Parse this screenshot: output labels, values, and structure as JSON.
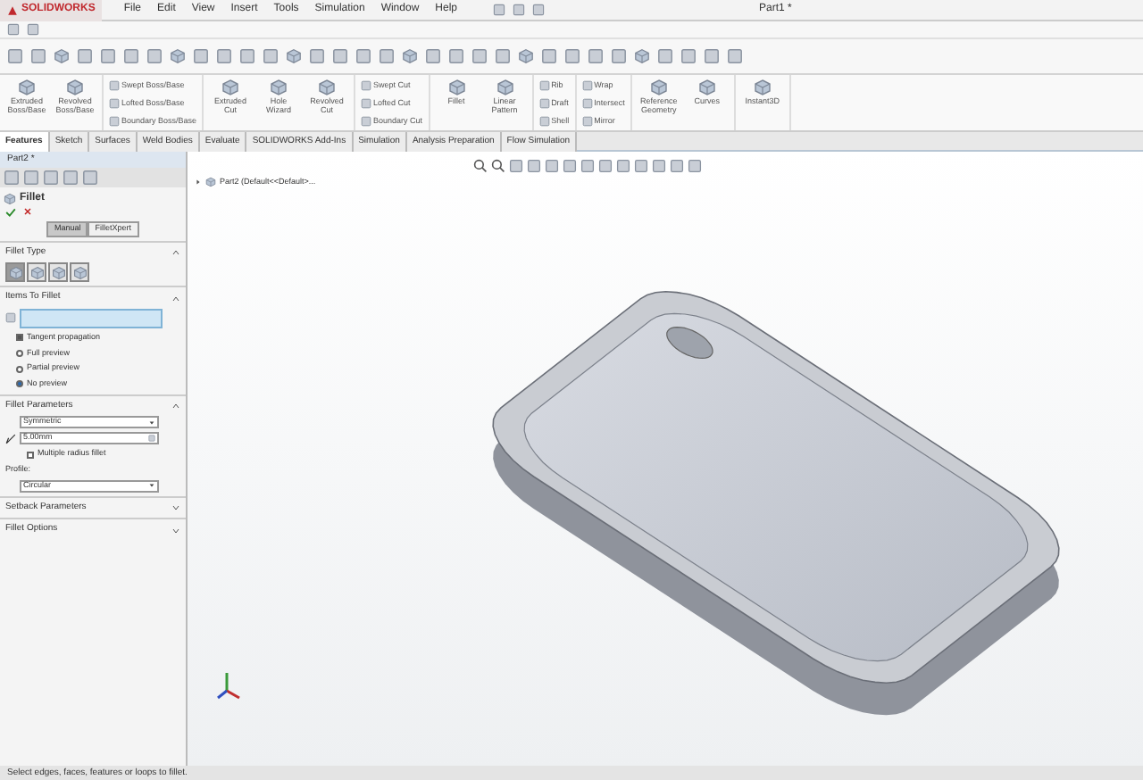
{
  "app": {
    "logo": "SOLIDWORKS",
    "menu": [
      "File",
      "Edit",
      "View",
      "Insert",
      "Tools",
      "Simulation",
      "Window",
      "Help"
    ],
    "title": "Part1 *"
  },
  "ribbon": [
    {
      "kind": "big",
      "labels": [
        "Extruded Boss/Base",
        "Revolved Boss/Base"
      ]
    },
    {
      "kind": "small",
      "labels": [
        "Swept Boss/Base",
        "Lofted Boss/Base",
        "Boundary Boss/Base"
      ]
    },
    {
      "kind": "big",
      "labels": [
        "Extruded Cut",
        "Hole Wizard",
        "Revolved Cut"
      ]
    },
    {
      "kind": "small",
      "labels": [
        "Swept Cut",
        "Lofted Cut",
        "Boundary Cut"
      ]
    },
    {
      "kind": "big",
      "labels": [
        "Fillet",
        "Linear Pattern"
      ]
    },
    {
      "kind": "small",
      "labels": [
        "Rib",
        "Draft",
        "Shell"
      ]
    },
    {
      "kind": "small",
      "labels": [
        "Wrap",
        "Intersect",
        "Mirror"
      ]
    },
    {
      "kind": "big",
      "labels": [
        "Reference Geometry",
        "Curves"
      ]
    },
    {
      "kind": "big",
      "labels": [
        "Instant3D"
      ]
    }
  ],
  "tabs": [
    {
      "label": "Features",
      "selected": true
    },
    {
      "label": "Sketch",
      "selected": false
    },
    {
      "label": "Surfaces",
      "selected": false
    },
    {
      "label": "Weld Bodies",
      "selected": false
    },
    {
      "label": "Evaluate",
      "selected": false
    },
    {
      "label": "SOLIDWORKS Add-Ins",
      "selected": false
    },
    {
      "label": "Simulation",
      "selected": false
    },
    {
      "label": "Analysis Preparation",
      "selected": false
    },
    {
      "label": "Flow Simulation",
      "selected": false
    }
  ],
  "document_tab": "Part2 *",
  "property_manager": {
    "title": "Fillet",
    "modes": [
      {
        "label": "Manual",
        "selected": true
      },
      {
        "label": "FilletXpert",
        "selected": false
      }
    ],
    "fillet_type": {
      "heading": "Fillet Type",
      "types": [
        {
          "selected": true
        },
        {
          "selected": false
        },
        {
          "selected": false
        },
        {
          "selected": false
        }
      ]
    },
    "items": {
      "heading": "Items To Fillet",
      "options": [
        {
          "kind": "checkbox",
          "label": "Tangent propagation",
          "checked": true
        },
        {
          "kind": "radio",
          "label": "Full preview",
          "selected": false
        },
        {
          "kind": "radio",
          "label": "Partial preview",
          "selected": false
        },
        {
          "kind": "radio",
          "label": "No preview",
          "selected": true
        }
      ]
    },
    "parameters": {
      "heading": "Fillet Parameters",
      "method": "Symmetric",
      "radius": "5.00mm",
      "multiple_radius": {
        "label": "Multiple radius fillet",
        "checked": false
      },
      "profile_label": "Profile:",
      "profile": "Circular"
    },
    "collapsed": [
      "Setback Parameters",
      "Fillet Options"
    ]
  },
  "tree": "Part2 (Default<<Default>...",
  "status_bar": "Select edges, faces, features or loops to fillet."
}
